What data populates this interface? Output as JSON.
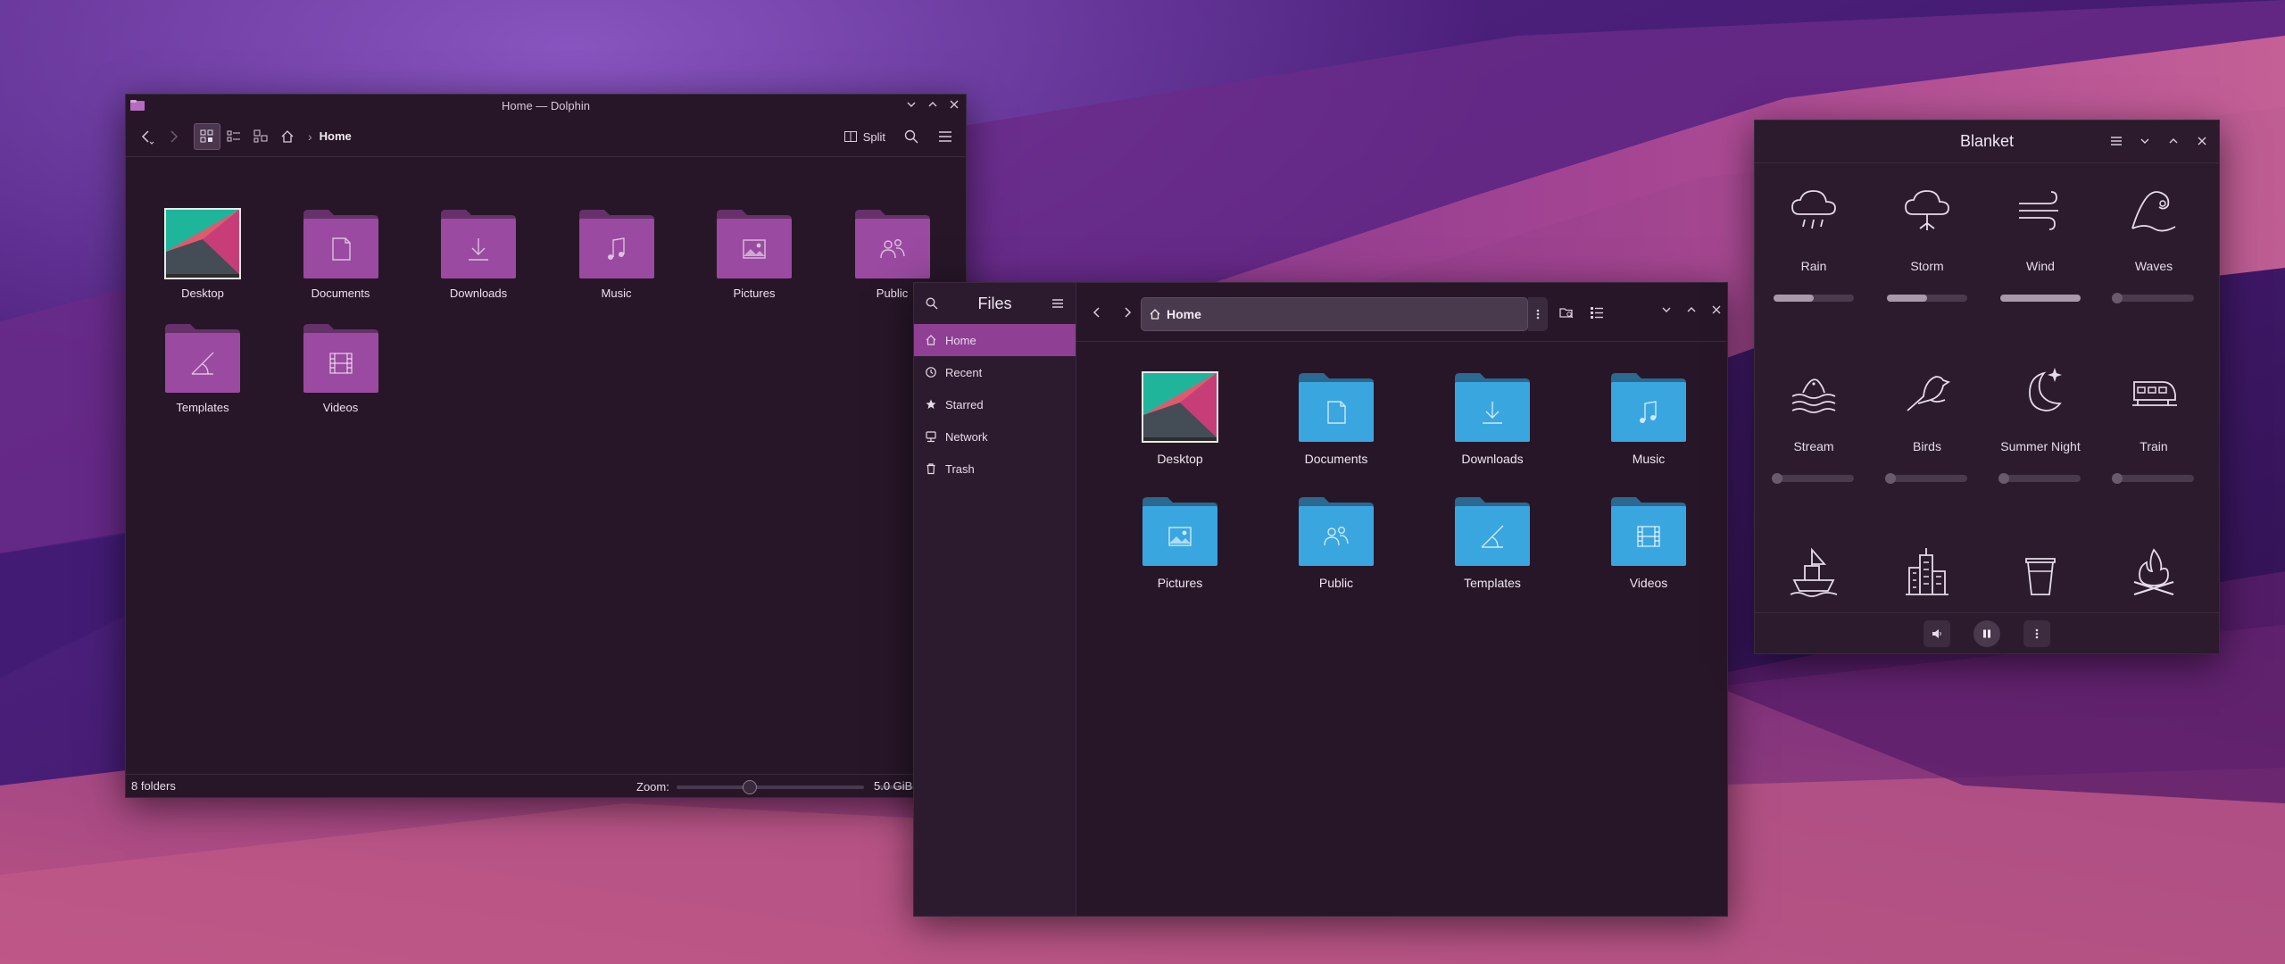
{
  "dolphin": {
    "title": "Home — Dolphin",
    "breadcrumb": "Home",
    "split_label": "Split",
    "items": [
      {
        "label": "Desktop",
        "kind": "desktop"
      },
      {
        "label": "Documents",
        "kind": "documents"
      },
      {
        "label": "Downloads",
        "kind": "downloads"
      },
      {
        "label": "Music",
        "kind": "music"
      },
      {
        "label": "Pictures",
        "kind": "pictures"
      },
      {
        "label": "Public",
        "kind": "public"
      },
      {
        "label": "Templates",
        "kind": "templates"
      },
      {
        "label": "Videos",
        "kind": "videos"
      }
    ],
    "status": {
      "folders": "8 folders",
      "zoom_label": "Zoom:",
      "zoom_level": 0.38,
      "free_space": "5.0 GiB"
    },
    "folder_color": "#9a4aa0"
  },
  "files": {
    "title": "Files",
    "location": "Home",
    "sidebar": [
      {
        "label": "Home",
        "icon": "home-icon",
        "active": true
      },
      {
        "label": "Recent",
        "icon": "clock-icon"
      },
      {
        "label": "Starred",
        "icon": "star-icon"
      },
      {
        "label": "Network",
        "icon": "network-icon"
      },
      {
        "label": "Trash",
        "icon": "trash-icon"
      }
    ],
    "items": [
      {
        "label": "Desktop",
        "kind": "desktop"
      },
      {
        "label": "Documents",
        "kind": "documents"
      },
      {
        "label": "Downloads",
        "kind": "downloads"
      },
      {
        "label": "Music",
        "kind": "music"
      },
      {
        "label": "Pictures",
        "kind": "pictures"
      },
      {
        "label": "Public",
        "kind": "public"
      },
      {
        "label": "Templates",
        "kind": "templates"
      },
      {
        "label": "Videos",
        "kind": "videos"
      }
    ],
    "folder_color": "#3aa6e0",
    "accent": "#8f3f94"
  },
  "blanket": {
    "title": "Blanket",
    "sounds": [
      {
        "name": "Rain",
        "icon": "rain-icon",
        "volume": 0.5
      },
      {
        "name": "Storm",
        "icon": "storm-icon",
        "volume": 0.5
      },
      {
        "name": "Wind",
        "icon": "wind-icon",
        "volume": 1.0
      },
      {
        "name": "Waves",
        "icon": "waves-icon",
        "volume": 0.0
      },
      {
        "name": "Stream",
        "icon": "stream-icon",
        "volume": 0.0
      },
      {
        "name": "Birds",
        "icon": "birds-icon",
        "volume": 0.0
      },
      {
        "name": "Summer Night",
        "icon": "summer-night-icon",
        "volume": 0.0
      },
      {
        "name": "Train",
        "icon": "train-icon",
        "volume": 0.0
      },
      {
        "name": "",
        "icon": "boat-icon",
        "volume": 0.0
      },
      {
        "name": "",
        "icon": "city-icon",
        "volume": 0.0
      },
      {
        "name": "",
        "icon": "coffee-icon",
        "volume": 0.0
      },
      {
        "name": "",
        "icon": "fireplace-icon",
        "volume": 0.0
      }
    ]
  }
}
